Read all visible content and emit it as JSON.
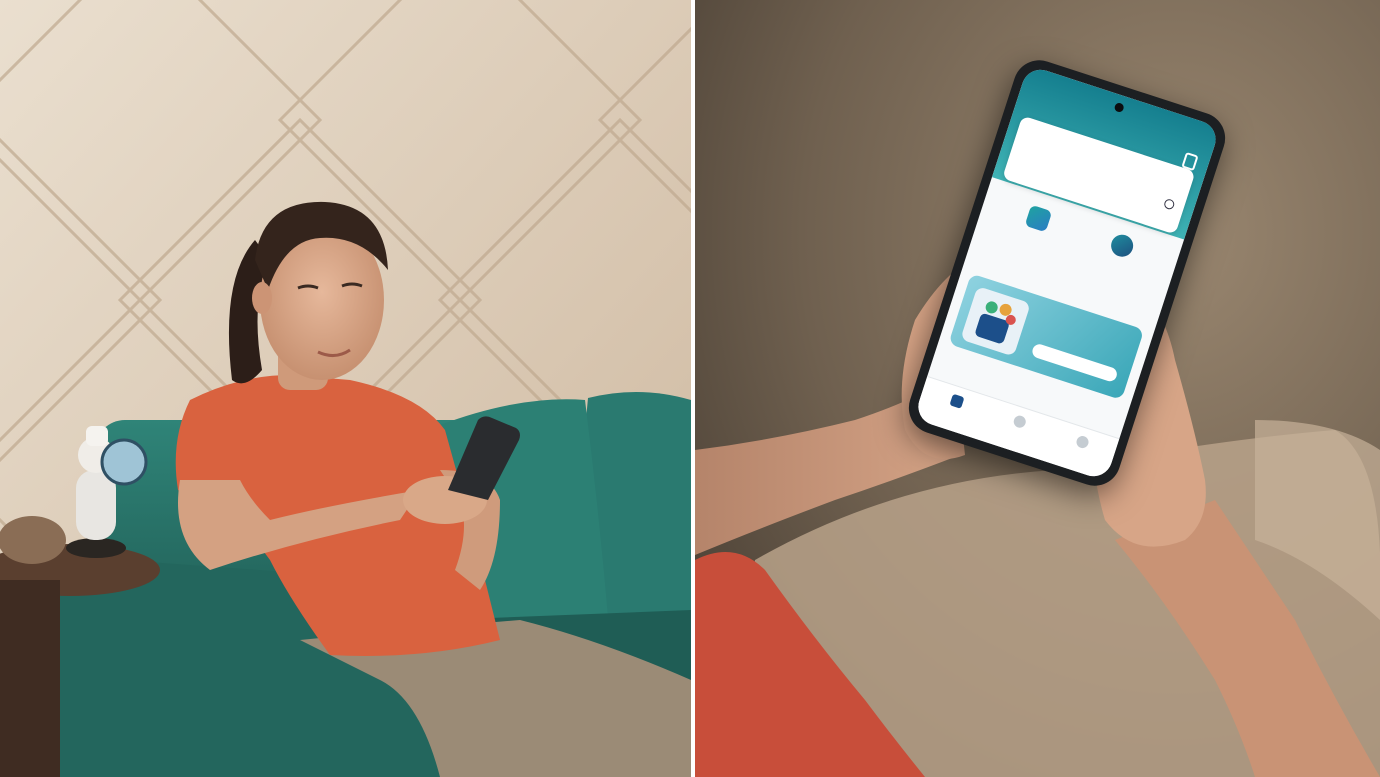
{
  "scene": {
    "colors": {
      "wall": "#dccab4",
      "sofa": "#2e7e73",
      "shirt": "#d9623f",
      "pants": "#9a8a74",
      "skin": "#d6a484",
      "phone_accent": "#1f8fa0"
    }
  },
  "phone_app": {
    "brand": "",
    "account_label": "",
    "greeting": "",
    "card": {
      "line1": "",
      "line2": "",
      "line3": "",
      "right1": "",
      "right2": ""
    },
    "services": [
      {
        "label": "",
        "icon": "transfer-icon"
      },
      {
        "label": "",
        "icon": "gear-icon"
      }
    ],
    "promo_title": "",
    "promo_subtitle": "",
    "banner": {
      "text": "",
      "button_label": ""
    },
    "nav": [
      {
        "label": "",
        "icon": "home-icon",
        "active": true
      },
      {
        "label": "",
        "icon": "history-icon",
        "active": false
      },
      {
        "label": "",
        "icon": "profile-icon",
        "active": false
      }
    ]
  }
}
